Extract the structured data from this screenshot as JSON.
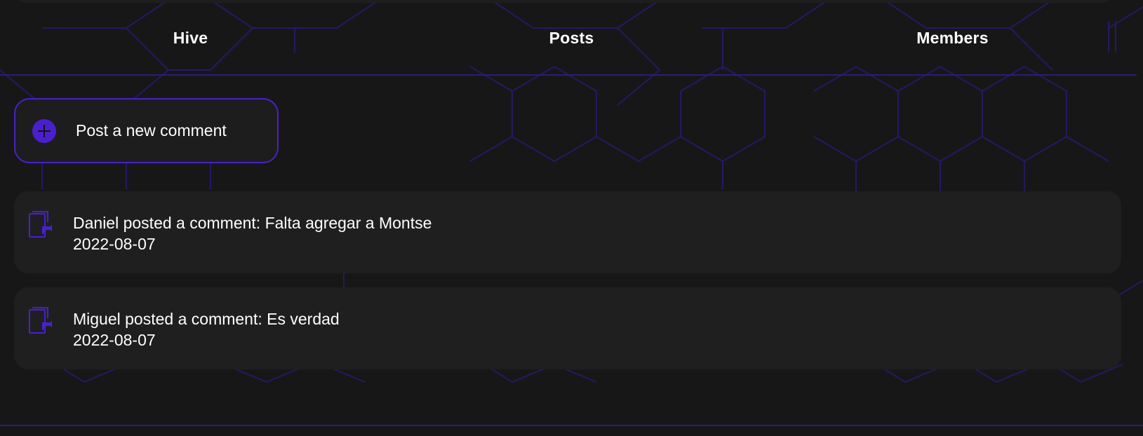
{
  "tabs": [
    {
      "label": "Hive"
    },
    {
      "label": "Posts"
    },
    {
      "label": "Members"
    }
  ],
  "actions": {
    "new_comment_label": "Post a new comment",
    "new_comment_icon": "plus-circle-icon"
  },
  "comments": [
    {
      "author": "Daniel",
      "line": "Daniel posted a comment: Falta agregar a Montse",
      "date": "2022-08-07",
      "icon": "comment-card-icon"
    },
    {
      "author": "Miguel",
      "line": "Miguel posted a comment: Es verdad",
      "date": "2022-08-07",
      "icon": "comment-card-icon"
    }
  ],
  "colors": {
    "background": "#171717",
    "card": "#1f1f1f",
    "accent": "#4a1fd0",
    "pattern": "#231a66",
    "text": "#ffffff"
  }
}
